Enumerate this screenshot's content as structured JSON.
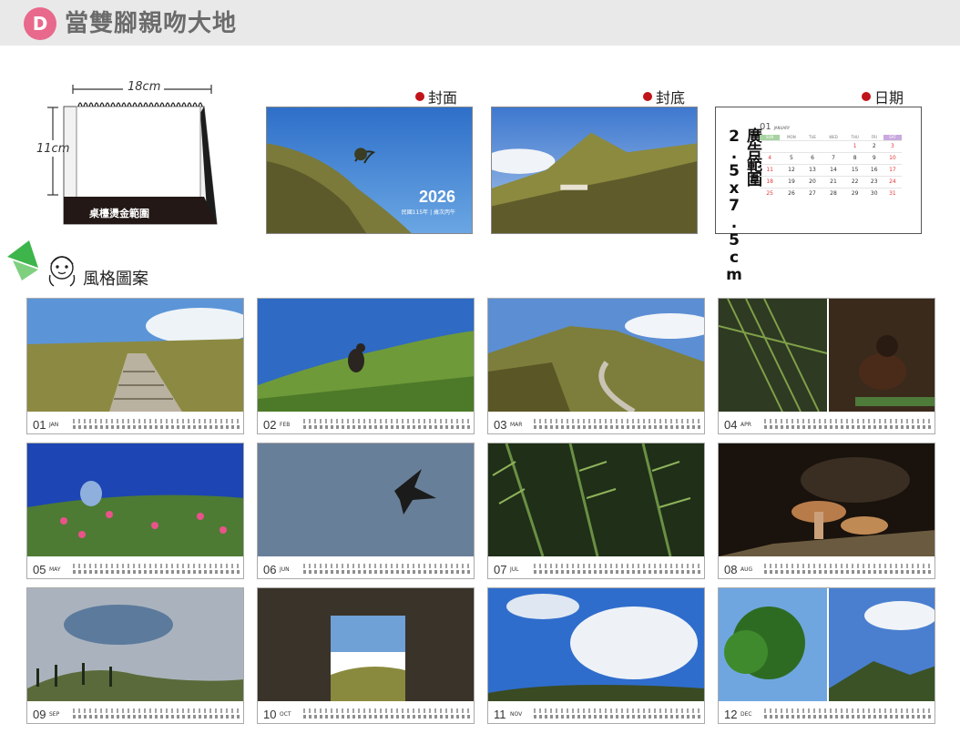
{
  "header": {
    "badge": "D",
    "title": "當雙腳親吻大地"
  },
  "desk_illustration": {
    "width_label": "18cm",
    "height_label": "11cm",
    "base_label": "桌檯燙金範圍"
  },
  "previews": {
    "cover": {
      "label": "封面",
      "year": "2026",
      "subtitle": "民國115年 | 歲次丙午"
    },
    "back": {
      "label": "封底"
    },
    "date": {
      "label": "日期",
      "ad_area": "廣告範圍 2.5x7.5cm",
      "month_num": "01",
      "month_name": "JANUARY",
      "weekdays": [
        "SUN",
        "MON",
        "TUE",
        "WED",
        "THU",
        "FRI",
        "SAT"
      ],
      "weeks": [
        [
          "",
          "",
          "",
          "",
          "1",
          "2",
          "3"
        ],
        [
          "4",
          "5",
          "6",
          "7",
          "8",
          "9",
          "10"
        ],
        [
          "11",
          "12",
          "13",
          "14",
          "15",
          "16",
          "17"
        ],
        [
          "18",
          "19",
          "20",
          "21",
          "22",
          "23",
          "24"
        ],
        [
          "25",
          "26",
          "27",
          "28",
          "29",
          "30",
          "31"
        ]
      ]
    }
  },
  "style_section": {
    "label": "風格圖案"
  },
  "months": [
    {
      "num": "01",
      "name": "JAN",
      "scene": "steps"
    },
    {
      "num": "02",
      "name": "FEB",
      "scene": "bird-grass"
    },
    {
      "num": "03",
      "name": "MAR",
      "scene": "mountain-road"
    },
    {
      "num": "04",
      "name": "APR",
      "scene": "bird-split"
    },
    {
      "num": "05",
      "name": "MAY",
      "scene": "flowers"
    },
    {
      "num": "06",
      "name": "JUN",
      "scene": "eagle"
    },
    {
      "num": "07",
      "name": "JUL",
      "scene": "fern"
    },
    {
      "num": "08",
      "name": "AUG",
      "scene": "mushroom"
    },
    {
      "num": "09",
      "name": "SEP",
      "scene": "mist"
    },
    {
      "num": "10",
      "name": "OCT",
      "scene": "window"
    },
    {
      "num": "11",
      "name": "NOV",
      "scene": "clouds"
    },
    {
      "num": "12",
      "name": "DEC",
      "scene": "tree-split"
    }
  ],
  "colors": {
    "badge": "#e8698c",
    "header_bg": "#e9e9e9",
    "label_dot": "#c0131a",
    "sky": "#3d7fd4"
  }
}
